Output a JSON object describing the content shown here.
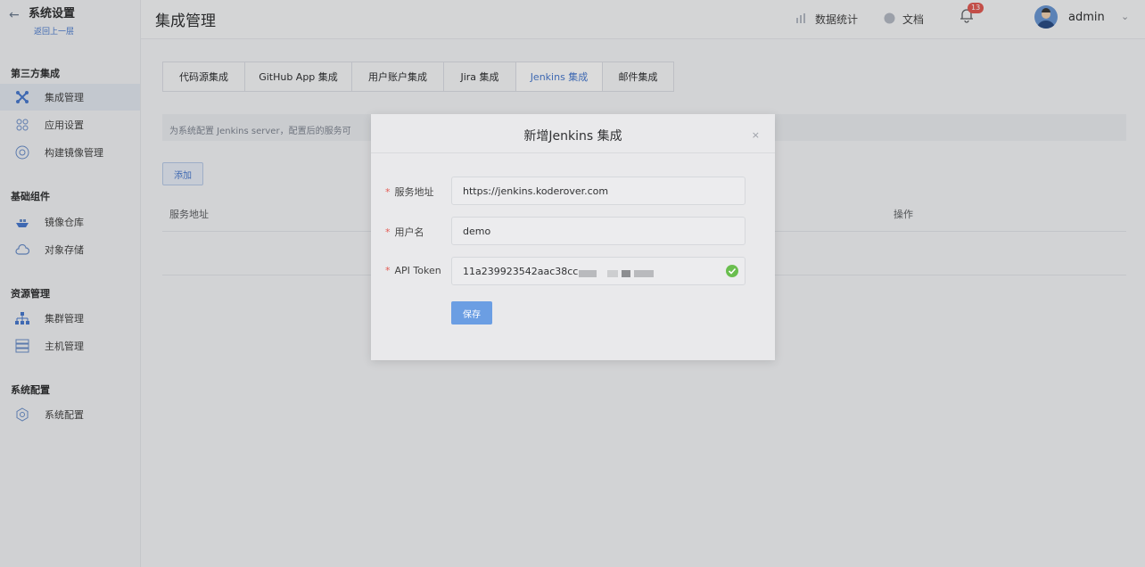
{
  "sidebar": {
    "title": "系统设置",
    "back_link": "返回上一层",
    "sections": {
      "integration": "第三方集成",
      "components": "基础组件",
      "resources": "资源管理",
      "config": "系统配置"
    },
    "items": {
      "integration_mgmt": "集成管理",
      "app_settings": "应用设置",
      "build_image": "构建镜像管理",
      "image_registry": "镜像仓库",
      "object_storage": "对象存储",
      "cluster_mgmt": "集群管理",
      "host_mgmt": "主机管理",
      "system_config": "系统配置"
    }
  },
  "header": {
    "page_title": "集成管理",
    "stats": "数据统计",
    "docs": "文档",
    "notification_count": "13",
    "username": "admin"
  },
  "tabs": [
    "代码源集成",
    "GitHub App 集成",
    "用户账户集成",
    "Jira 集成",
    "Jenkins 集成",
    "邮件集成"
  ],
  "active_tab": "Jenkins 集成",
  "main": {
    "alert": "为系统配置 Jenkins server，配置后的服务可",
    "add_button": "添加",
    "columns": {
      "address": "服务地址",
      "actions": "操作"
    }
  },
  "dialog": {
    "title": "新增Jenkins 集成",
    "close": "×",
    "fields": {
      "address": {
        "label": "服务地址",
        "value": "https://jenkins.koderover.com"
      },
      "username": {
        "label": "用户名",
        "value": "demo"
      },
      "token": {
        "label": "API Token",
        "value": "11a239923542aac38cc"
      }
    },
    "required_mark": "*",
    "save_button": "保存"
  },
  "colors": {
    "accent": "#4a7bd0",
    "primary_button": "#6b9ee3",
    "required": "#e45b54",
    "valid": "#6abe4f"
  }
}
